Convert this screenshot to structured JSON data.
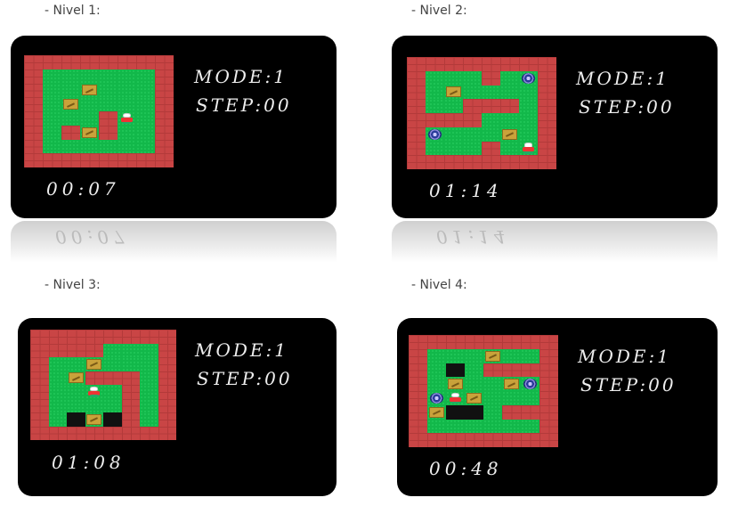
{
  "levels": [
    {
      "caption": "- Nivel 1:",
      "mode": "MODE:1",
      "step": "STEP:00",
      "timer": "00:07",
      "reflection": "00:07",
      "map": [
        "WWWWWWWW",
        "WFFFFFFW",
        "WFFBFFFW",
        "WFBFFFFW",
        "WFFFWPFW",
        "WFWBWFFW",
        "WFFFFFFW",
        "WWWWWWWW"
      ]
    },
    {
      "caption": "- Nivel 2:",
      "mode": "MODE:1",
      "step": "STEP:00",
      "timer": "01:14",
      "reflection": "01:14",
      "map": [
        "WWWWWWWW",
        "WFFFWFTW",
        "WFBFFFFW",
        "WFFWWWFW",
        "WWWWFFFW",
        "WTFFFBFW",
        "WFFFWFPW",
        "WWWWWWWW"
      ]
    },
    {
      "caption": "- Nivel 3:",
      "mode": "MODE:1",
      "step": "STEP:00",
      "timer": "01:08",
      "map": [
        "WWWWWWWW",
        "WWWWFFFW",
        "WFFBFFFW",
        "WFBWWWFW",
        "WFFPFWFW",
        "WFFFFWFW",
        "WFXBXWFW",
        "WWWWWWWW"
      ]
    },
    {
      "caption": "- Nivel 4:",
      "mode": "MODE:1",
      "step": "STEP:00",
      "timer": "00:48",
      "map": [
        "WWWWWWWW",
        "WFFFBFFW",
        "WFXFWWWW",
        "WFBFFBTW",
        "WTPBFFFW",
        "WBXXFWWW",
        "WFFFFFFW",
        "WWWWWWWW"
      ]
    }
  ]
}
